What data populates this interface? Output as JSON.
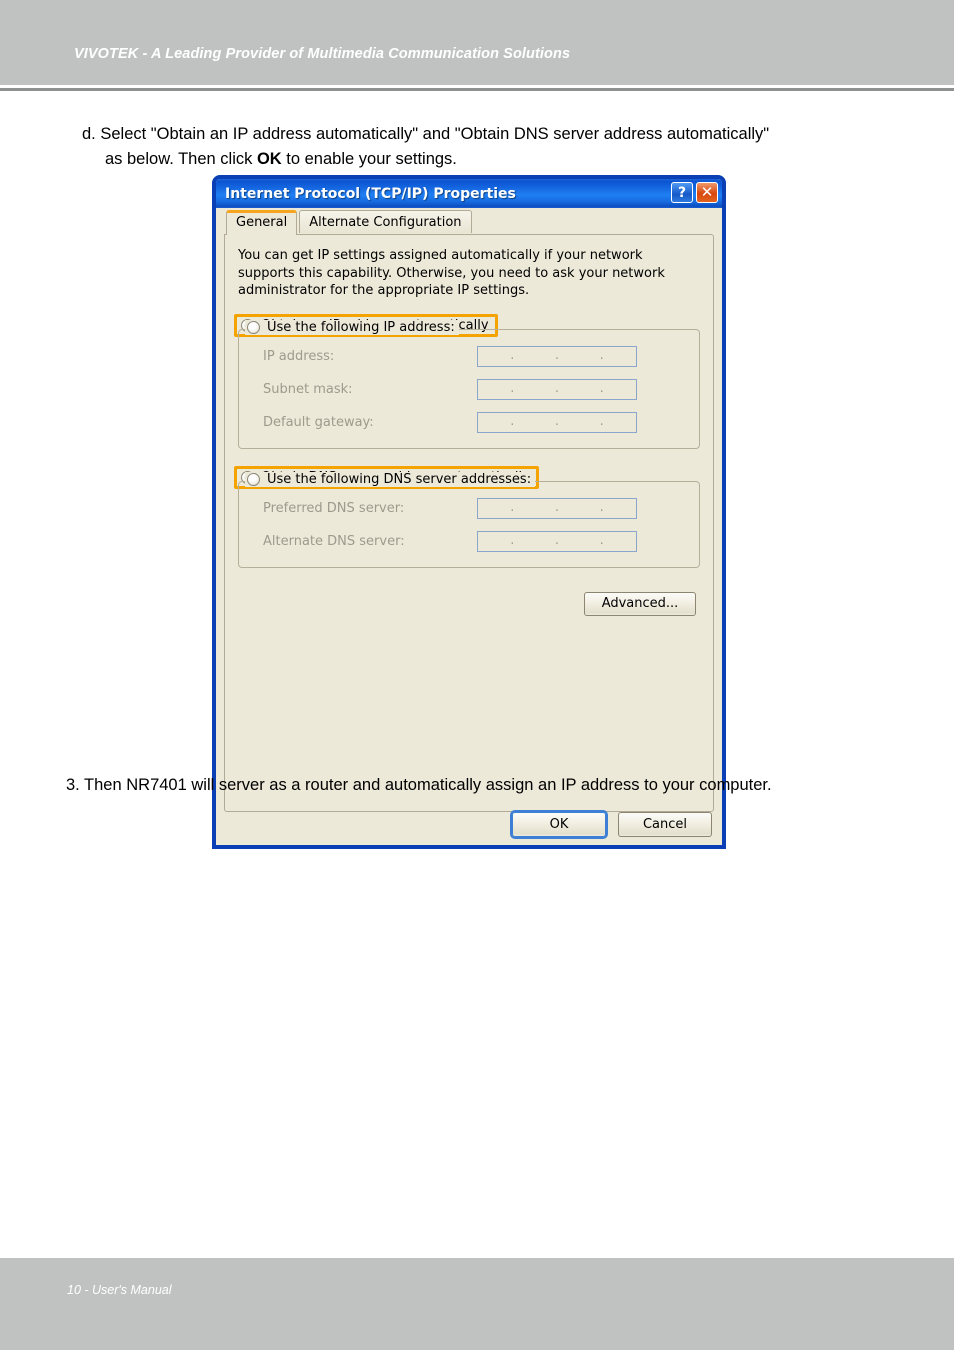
{
  "page": {
    "header_title": "VIVOTEK - A Leading Provider of Multimedia Communication Solutions",
    "footer_text": "10 - User's Manual"
  },
  "instructions": {
    "step_d_line1": "d. Select \"Obtain an IP address automatically\" and \"Obtain DNS server address automatically\"",
    "step_d_line2_a": "as below. Then click ",
    "step_d_bold": "OK",
    "step_d_line2_b": " to enable your settings.",
    "step_3": "3. Then NR7401 will server as a router and automatically assign an IP address to your computer."
  },
  "dialog": {
    "title": "Internet Protocol (TCP/IP) Properties",
    "help_icon": "?",
    "close_icon": "✕",
    "tabs": [
      {
        "label": "General",
        "active": true
      },
      {
        "label": "Alternate Configuration",
        "active": false
      }
    ],
    "description": "You can get IP settings assigned automatically if your network supports this capability. Otherwise, you need to ask your network administrator for the appropriate IP settings.",
    "ip_section": {
      "auto_radio_label": "Obtain an IP address automatically",
      "auto_radio_selected": true,
      "auto_radio_highlighted": true,
      "manual_radio_label": "Use the following IP address:",
      "manual_radio_selected": false,
      "fields": [
        {
          "label": "IP address:",
          "value": ""
        },
        {
          "label": "Subnet mask:",
          "value": ""
        },
        {
          "label": "Default gateway:",
          "value": ""
        }
      ]
    },
    "dns_section": {
      "auto_radio_label": "Obtain DNS server address automatically",
      "auto_radio_selected": true,
      "auto_radio_highlighted": true,
      "manual_radio_label": "Use the following DNS server addresses:",
      "manual_radio_selected": false,
      "fields": [
        {
          "label": "Preferred DNS server:",
          "value": ""
        },
        {
          "label": "Alternate DNS server:",
          "value": ""
        }
      ]
    },
    "advanced_button": "Advanced...",
    "ok_button": "OK",
    "cancel_button": "Cancel"
  },
  "colors": {
    "band_gray": "#c0c2c1",
    "titlebar_blue": "#1f7ff4",
    "highlight_orange": "#f5a300",
    "radio_green": "#1faa1f",
    "dialog_face": "#ece9d8"
  }
}
